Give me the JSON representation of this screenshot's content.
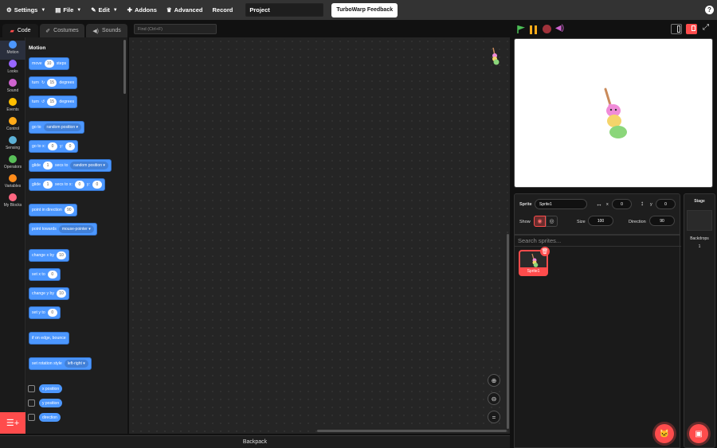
{
  "menubar": {
    "settings": "Settings",
    "file": "File",
    "edit": "Edit",
    "addons": "Addons",
    "advanced": "Advanced",
    "record": "Record",
    "project_title": "Project",
    "feedback": "TurboWarp Feedback",
    "help": "?"
  },
  "tabs": {
    "code": "Code",
    "costumes": "Costumes",
    "sounds": "Sounds"
  },
  "find_placeholder": "Find (Ctrl+F)",
  "categories": {
    "motion": "Motion",
    "looks": "Looks",
    "sound": "Sound",
    "events": "Events",
    "control": "Control",
    "sensing": "Sensing",
    "operators": "Operators",
    "variables": "Variables",
    "myblocks": "My Blocks"
  },
  "colors": {
    "motion": "#4c97ff",
    "looks": "#9966ff",
    "sound": "#cf63cf",
    "events": "#ffbf00",
    "control": "#ffab19",
    "sensing": "#5cb1d6",
    "operators": "#59c059",
    "variables": "#ff8c1a",
    "myblocks": "#ff6680",
    "accent": "#ff4c4c"
  },
  "palette": {
    "heading": "Motion",
    "move": "move",
    "move_val": "10",
    "steps": "steps",
    "turn": "turn",
    "turn_val": "15",
    "degrees": "degrees",
    "goto": "go to",
    "random_position": "random position",
    "goto_xy": "go to x:",
    "x_val": "0",
    "y_label": "y:",
    "y_val": "0",
    "glide": "glide",
    "glide_val": "1",
    "secs_to": "secs to",
    "secs_to_x": "secs to x:",
    "point_dir": "point in direction",
    "dir_val": "90",
    "point_towards": "point towards",
    "mouse_pointer": "mouse-pointer",
    "change_x": "change x by",
    "set_x": "set x to",
    "change_y": "change y by",
    "set_y": "set y to",
    "edge_bounce": "if on edge, bounce",
    "rotation_style": "set rotation style",
    "left_right": "left-right",
    "x_position": "x position",
    "y_position": "y position",
    "direction": "direction"
  },
  "backpack": "Backpack",
  "sprite_info": {
    "sprite_label": "Sprite",
    "sprite_name": "Sprite1",
    "x_label": "x",
    "x_val": "0",
    "y_label": "y",
    "y_val": "0",
    "show_label": "Show",
    "size_label": "Size",
    "size_val": "100",
    "direction_label": "Direction",
    "direction_val": "90"
  },
  "search_sprites": "Search sprites...",
  "sprite_tile_name": "Sprite1",
  "stage_panel": {
    "title": "Stage",
    "backdrops": "Backdrops",
    "count": "1"
  }
}
